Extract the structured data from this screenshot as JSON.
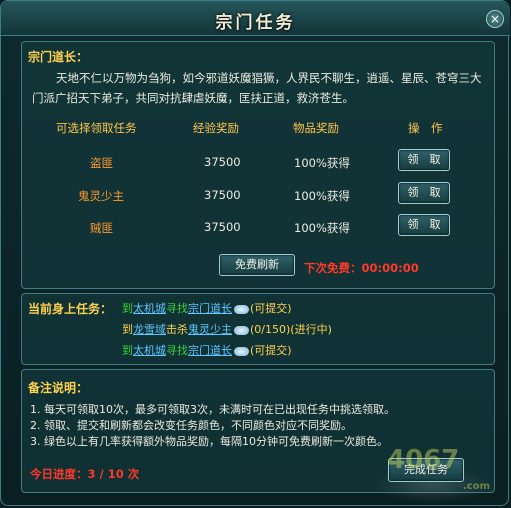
{
  "window": {
    "title": "宗门任务",
    "close_label": "×"
  },
  "elder": {
    "heading": "宗门道长：",
    "intro": "天地不仁以万物为刍狗，如今邪道妖魔猖獗，人界民不聊生，逍遥、星辰、苍穹三大门派广招天下弟子，共同对抗肆虐妖魔，匡扶正道，救济苍生。"
  },
  "table": {
    "headers": [
      "可选择领取任务",
      "经验奖励",
      "物品奖励",
      "操　作"
    ],
    "rows": [
      {
        "name": "盗匪",
        "exp": "37500",
        "item": "100%获得",
        "action": "领　取"
      },
      {
        "name": "鬼灵少主",
        "exp": "37500",
        "item": "100%获得",
        "action": "领　取"
      },
      {
        "name": "贼匪",
        "exp": "37500",
        "item": "100%获得",
        "action": "领　取"
      }
    ]
  },
  "refresh": {
    "button_label": "免费刷新",
    "next_free_label": "下次免费：",
    "timer": "00:00:00"
  },
  "current": {
    "heading": "当前身上任务：",
    "tasks": [
      {
        "prefix": "到",
        "place": "太机城",
        "verb": "寻找",
        "target": "宗门道长",
        "status": "(可提交)"
      },
      {
        "prefix": "到",
        "place": "龙雪域",
        "verb": "击杀",
        "target": "鬼灵少主",
        "progress": "(0/150)",
        "status": "(进行中)"
      },
      {
        "prefix": "到",
        "place": "太机城",
        "verb": "寻找",
        "target": "宗门道长",
        "status": "(可提交)"
      }
    ]
  },
  "notes": {
    "heading": "备注说明：",
    "items": [
      "1. 每天可领取10次，最多可领取3次，未满时可在已出现任务中挑选领取。",
      "2. 领取、提交和刷新都会改变任务颜色，不同颜色对应不同奖励。",
      "3. 绿色以上有几率获得额外物品奖励，每隔10分钟可免费刷新一次颜色。"
    ],
    "progress_label": "今日进度：3 / 10 次",
    "complete_button": "完成任务"
  },
  "watermark": {
    "text": "4067",
    "suffix": ".com"
  },
  "icons": {
    "close": "close-icon",
    "cloud": "cloud-icon"
  }
}
